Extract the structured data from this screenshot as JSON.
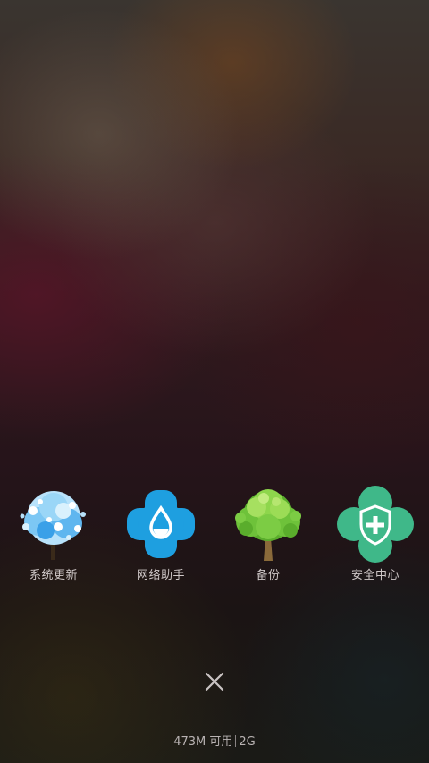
{
  "shortcuts": [
    {
      "label": "系统更新",
      "icon": "snow-tree-icon",
      "color": "#3aa0e8"
    },
    {
      "label": "网络助手",
      "icon": "water-drop-clover-icon",
      "color": "#1e9fe0"
    },
    {
      "label": "备份",
      "icon": "green-tree-icon",
      "color": "#6ec23a"
    },
    {
      "label": "安全中心",
      "icon": "shield-clover-icon",
      "color": "#3fb889"
    }
  ],
  "close": {
    "icon": "close-icon"
  },
  "memory": {
    "available": "473M 可用",
    "total": "2G"
  }
}
